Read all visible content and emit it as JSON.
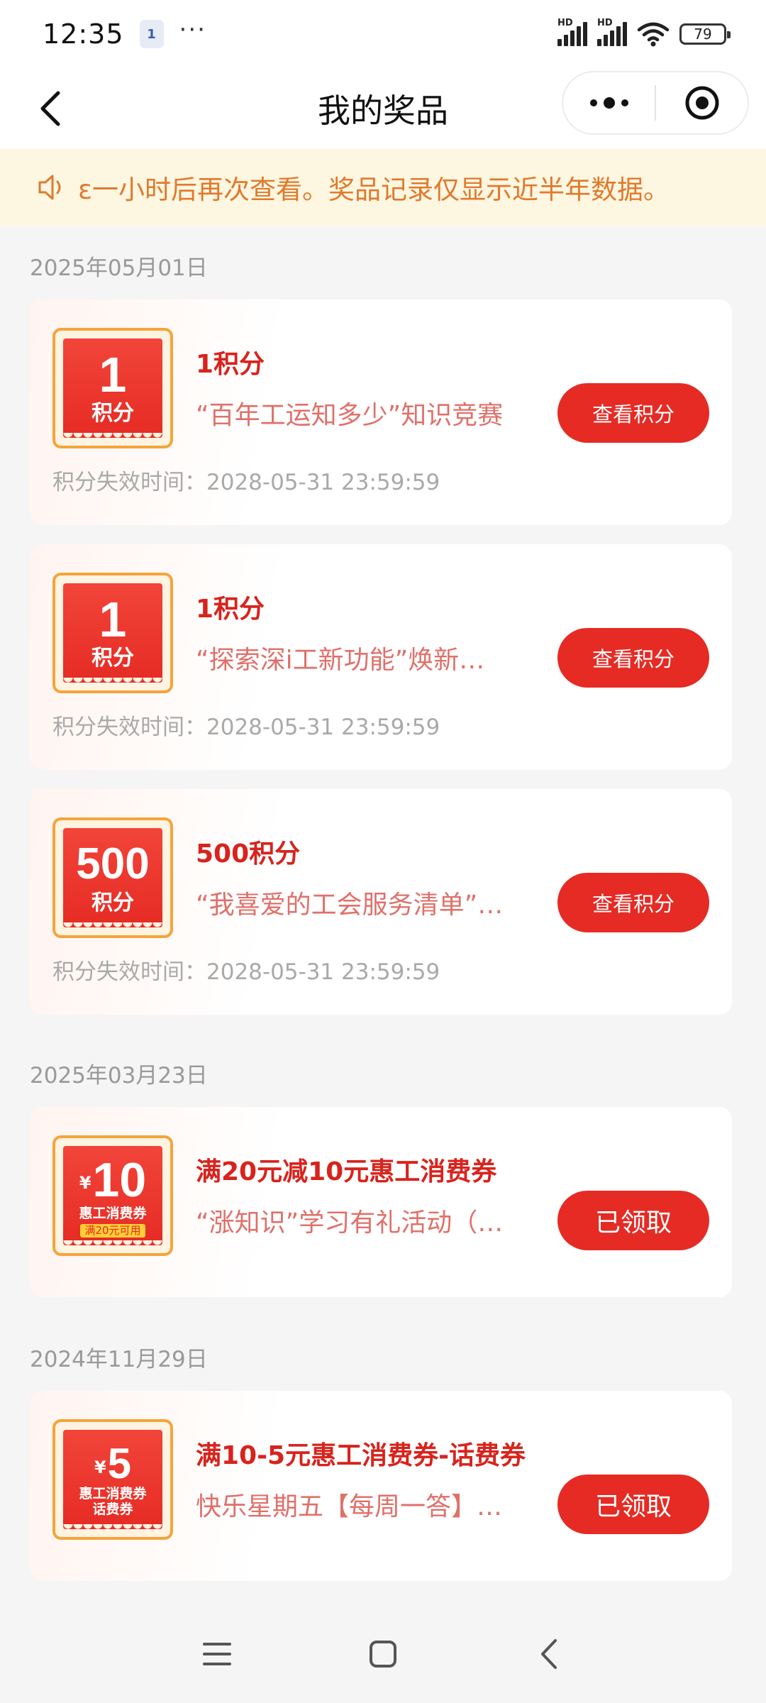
{
  "status_bar": {
    "time": "12:35",
    "app_icon_label": "1",
    "more_dots": "···",
    "signal_1_label": "HD",
    "signal_2_label": "HD",
    "battery": "79"
  },
  "nav": {
    "title": "我的奖品"
  },
  "notice": {
    "text": "ɛ一小时后再次查看。奖品记录仅显示近半年数据。"
  },
  "groups": [
    {
      "date": "2025年05月01日",
      "items": [
        {
          "coupon_value": "1",
          "coupon_unit": "积分",
          "title": "1积分",
          "desc": "“百年工运知多少”知识竞赛",
          "expire": "积分失效时间：2028-05-31 23:59:59",
          "button": "查看积分"
        },
        {
          "coupon_value": "1",
          "coupon_unit": "积分",
          "title": "1积分",
          "desc": "“探索深i工新功能”焕新…",
          "expire": "积分失效时间：2028-05-31 23:59:59",
          "button": "查看积分"
        },
        {
          "coupon_value": "500",
          "coupon_unit": "积分",
          "title": "500积分",
          "desc": "“我喜爱的工会服务清单”…",
          "expire": "积分失效时间：2028-05-31 23:59:59",
          "button": "查看积分"
        }
      ]
    },
    {
      "date": "2025年03月23日",
      "items": [
        {
          "coupon_yen": "¥",
          "coupon_value": "10",
          "coupon_sub": "惠工消费券",
          "coupon_tag": "满20元可用",
          "title": "满20元减10元惠工消费券",
          "desc": "“涨知识”学习有礼活动（…",
          "button": "已领取"
        }
      ]
    },
    {
      "date": "2024年11月29日",
      "items": [
        {
          "coupon_yen": "¥",
          "coupon_value": "5",
          "coupon_sub": "惠工消费券",
          "coupon_sub2": "话费券",
          "title": "满10-5元惠工消费券-话费券",
          "desc": "快乐星期五【每周一答】…",
          "button": "已领取"
        }
      ]
    }
  ],
  "icons": {
    "back": "chevron-left-icon",
    "more": "more-dots-icon",
    "close": "target-icon",
    "notice": "speaker-icon",
    "menu": "menu-icon",
    "home": "home-square-icon",
    "sys_back": "back-arrow-icon"
  },
  "colors": {
    "accent": "#e52b24",
    "title_red": "#d8231d",
    "notice_bg": "#fdf6e1",
    "notice_text": "#e07a2c",
    "coupon_border": "#f5a43a"
  }
}
